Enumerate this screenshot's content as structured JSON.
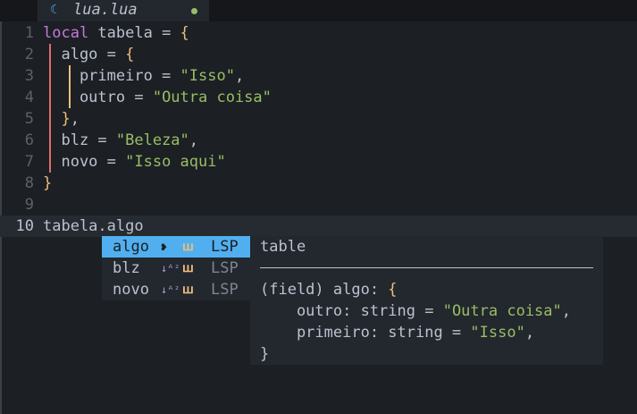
{
  "tab": {
    "icon": "lua-file-icon",
    "title": "lua.lua",
    "modified": true
  },
  "editor": {
    "lines": [
      {
        "num": "1",
        "segments": [
          {
            "t": "local",
            "c": "kw"
          },
          {
            "t": " tabela = ",
            "c": ""
          },
          {
            "t": "{",
            "c": "br"
          }
        ]
      },
      {
        "num": "2",
        "segments": [
          {
            "t": "  algo = ",
            "c": ""
          },
          {
            "t": "{",
            "c": "br"
          }
        ]
      },
      {
        "num": "3",
        "segments": [
          {
            "t": "    primeiro = ",
            "c": ""
          },
          {
            "t": "\"Isso\"",
            "c": "str"
          },
          {
            "t": ",",
            "c": ""
          }
        ]
      },
      {
        "num": "4",
        "segments": [
          {
            "t": "    outro = ",
            "c": ""
          },
          {
            "t": "\"Outra coisa\"",
            "c": "str"
          }
        ]
      },
      {
        "num": "5",
        "segments": [
          {
            "t": "  ",
            "c": ""
          },
          {
            "t": "}",
            "c": "br"
          },
          {
            "t": ",",
            "c": ""
          }
        ]
      },
      {
        "num": "6",
        "segments": [
          {
            "t": "  blz = ",
            "c": ""
          },
          {
            "t": "\"Beleza\"",
            "c": "str"
          },
          {
            "t": ",",
            "c": ""
          }
        ]
      },
      {
        "num": "7",
        "segments": [
          {
            "t": "  novo = ",
            "c": ""
          },
          {
            "t": "\"Isso aqui\"",
            "c": "str"
          }
        ]
      },
      {
        "num": "8",
        "segments": [
          {
            "t": "}",
            "c": "br"
          }
        ]
      },
      {
        "num": "9",
        "segments": []
      },
      {
        "num": "10",
        "segments": [
          {
            "t": "tabela.algo",
            "c": ""
          }
        ],
        "current": true
      }
    ]
  },
  "completion": {
    "items": [
      {
        "label": "algo",
        "kind_icon": "field-icon",
        "kind_glyph": "❥",
        "source_icon": "lua-lsp-icon",
        "source_glyph": "ꟺ",
        "source": "LSP",
        "selected": true
      },
      {
        "label": "blz",
        "kind_icon": "sort-az-icon",
        "kind_glyph": "↓ᴬᶻ",
        "source_icon": "lua-lsp-icon",
        "source_glyph": "ꟺ",
        "source": "LSP",
        "selected": false
      },
      {
        "label": "novo",
        "kind_icon": "sort-az-icon",
        "kind_glyph": "↓ᴬᶻ",
        "source_icon": "lua-lsp-icon",
        "source_glyph": "ꟺ",
        "source": "LSP",
        "selected": false
      }
    ]
  },
  "docs": {
    "header": "table",
    "signature": "(field) algo: ",
    "open_brace": "{",
    "field1": "    outro: string = ",
    "field1_value": "\"Outra coisa\"",
    "field1_comma": ",",
    "field2": "    primeiro: string = ",
    "field2_value": "\"Isso\"",
    "field2_comma": ",",
    "close_brace": "}"
  }
}
